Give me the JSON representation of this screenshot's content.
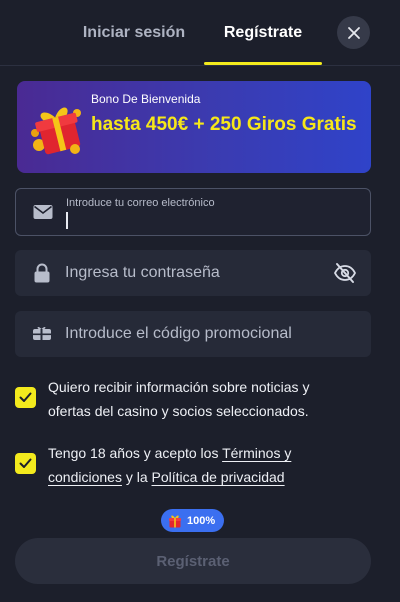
{
  "tabs": {
    "login_label": "Iniciar sesión",
    "register_label": "Regístrate"
  },
  "bonus": {
    "subtitle": "Bono De Bienvenida",
    "amount": "hasta 450€ + 250 Giros Gratis"
  },
  "email_field": {
    "label": "Introduce tu correo electrónico",
    "value": ""
  },
  "password_field": {
    "placeholder": "Ingresa tu contraseña"
  },
  "promo_field": {
    "placeholder": "Introduce el código promocional"
  },
  "consent_news": {
    "checked": true,
    "text": "Quiero recibir información sobre noticias y ofertas del casino y socios seleccionados."
  },
  "consent_age": {
    "checked": true,
    "prefix": "Tengo 18 años y acepto los ",
    "terms_link": "Términos y condiciones",
    "middle": " y la ",
    "privacy_link": "Política de privacidad"
  },
  "progress_badge": {
    "value": "100%"
  },
  "submit": {
    "label": "Regístrate"
  },
  "colors": {
    "accent": "#f3ea1d",
    "panel": "#1c1f2b",
    "badge": "#3b6ff0"
  },
  "icons": [
    "close-icon",
    "gift-icon",
    "mail-icon",
    "lock-icon",
    "eye-off-icon",
    "ticket-icon",
    "check-icon"
  ]
}
